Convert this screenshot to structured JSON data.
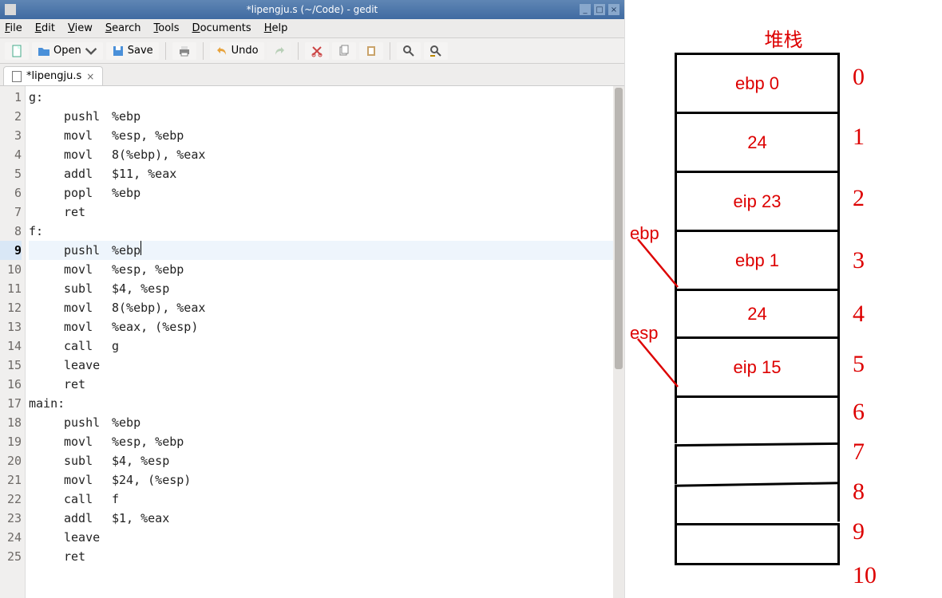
{
  "window": {
    "title": "*lipengju.s (~/Code) - gedit",
    "buttons": {
      "min": "_",
      "max": "□",
      "close": "×"
    }
  },
  "menus": {
    "file": "File",
    "edit": "Edit",
    "view": "View",
    "search": "Search",
    "tools": "Tools",
    "documents": "Documents",
    "help": "Help"
  },
  "toolbar": {
    "open": "Open",
    "save": "Save",
    "undo": "Undo"
  },
  "tab": {
    "name": "*lipengju.s"
  },
  "code": {
    "highlight": 9,
    "lines": [
      {
        "n": 1,
        "label": true,
        "text": "g:"
      },
      {
        "n": 2,
        "mnem": "pushl",
        "ops": "%ebp"
      },
      {
        "n": 3,
        "mnem": "movl",
        "ops": "%esp, %ebp"
      },
      {
        "n": 4,
        "mnem": "movl",
        "ops": "8(%ebp), %eax"
      },
      {
        "n": 5,
        "mnem": "addl",
        "ops": "$11, %eax"
      },
      {
        "n": 6,
        "mnem": "popl",
        "ops": "%ebp"
      },
      {
        "n": 7,
        "mnem": "ret",
        "ops": ""
      },
      {
        "n": 8,
        "label": true,
        "text": "f:"
      },
      {
        "n": 9,
        "mnem": "pushl",
        "ops": "%ebp",
        "cursor": true
      },
      {
        "n": 10,
        "mnem": "movl",
        "ops": "%esp, %ebp"
      },
      {
        "n": 11,
        "mnem": "subl",
        "ops": "$4, %esp"
      },
      {
        "n": 12,
        "mnem": "movl",
        "ops": "8(%ebp), %eax"
      },
      {
        "n": 13,
        "mnem": "movl",
        "ops": "%eax, (%esp)"
      },
      {
        "n": 14,
        "mnem": "call",
        "ops": "g"
      },
      {
        "n": 15,
        "mnem": "leave",
        "ops": ""
      },
      {
        "n": 16,
        "mnem": "ret",
        "ops": ""
      },
      {
        "n": 17,
        "label": true,
        "text": "main:"
      },
      {
        "n": 18,
        "mnem": "pushl",
        "ops": "%ebp"
      },
      {
        "n": 19,
        "mnem": "movl",
        "ops": "%esp, %ebp"
      },
      {
        "n": 20,
        "mnem": "subl",
        "ops": "$4, %esp"
      },
      {
        "n": 21,
        "mnem": "movl",
        "ops": "$24, (%esp)"
      },
      {
        "n": 22,
        "mnem": "call",
        "ops": "f"
      },
      {
        "n": 23,
        "mnem": "addl",
        "ops": "$1, %eax"
      },
      {
        "n": 24,
        "mnem": "leave",
        "ops": ""
      },
      {
        "n": 25,
        "mnem": "ret",
        "ops": ""
      }
    ]
  },
  "stack": {
    "title": "堆栈",
    "cells": [
      "ebp 0",
      "24",
      "eip 23",
      "ebp 1",
      "24",
      "eip 15",
      "",
      "",
      "",
      ""
    ],
    "indices": [
      "0",
      "1",
      "2",
      "3",
      "4",
      "5",
      "6",
      "7",
      "8",
      "9",
      "10"
    ],
    "ptr_ebp": "ebp",
    "ptr_esp": "esp"
  }
}
